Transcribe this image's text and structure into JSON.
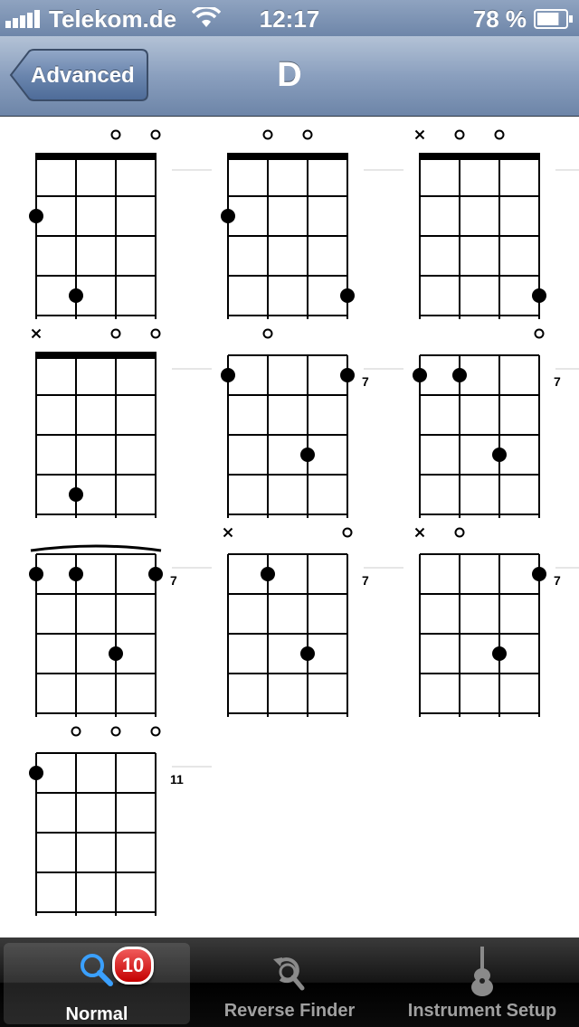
{
  "status_bar": {
    "carrier": "Telekom.de",
    "time": "12:17",
    "battery_percent": "78 %",
    "battery_level": 0.78,
    "signal_bars": 5,
    "icons": [
      "signal-icon",
      "wifi-icon",
      "battery-icon"
    ]
  },
  "nav": {
    "back_label": "Advanced",
    "title": "D"
  },
  "chord_diagrams": [
    {
      "strings": 4,
      "fret_rows": 4,
      "nut": true,
      "top": [
        "",
        "",
        "o",
        "o"
      ],
      "dots": [
        [
          0,
          2
        ],
        [
          1,
          4
        ]
      ],
      "fret_label": ""
    },
    {
      "strings": 4,
      "fret_rows": 4,
      "nut": true,
      "top": [
        "",
        "o",
        "o",
        ""
      ],
      "dots": [
        [
          0,
          2
        ],
        [
          3,
          4
        ]
      ],
      "fret_label": ""
    },
    {
      "strings": 4,
      "fret_rows": 4,
      "nut": true,
      "top": [
        "x",
        "o",
        "o",
        ""
      ],
      "dots": [
        [
          3,
          4
        ]
      ],
      "fret_label": ""
    },
    {
      "strings": 4,
      "fret_rows": 4,
      "nut": true,
      "top": [
        "x",
        "",
        "o",
        "o"
      ],
      "dots": [
        [
          1,
          4
        ]
      ],
      "fret_label": ""
    },
    {
      "strings": 4,
      "fret_rows": 4,
      "nut": false,
      "top": [
        "",
        "o",
        "",
        ""
      ],
      "dots": [
        [
          0,
          1
        ],
        [
          3,
          1
        ],
        [
          2,
          3
        ]
      ],
      "fret_label": "7"
    },
    {
      "strings": 4,
      "fret_rows": 4,
      "nut": false,
      "top": [
        "",
        "",
        "",
        "o"
      ],
      "dots": [
        [
          0,
          1
        ],
        [
          1,
          1
        ],
        [
          2,
          3
        ]
      ],
      "fret_label": "7"
    },
    {
      "strings": 4,
      "fret_rows": 4,
      "nut": false,
      "barre": true,
      "top": [
        "",
        "",
        "",
        ""
      ],
      "dots": [
        [
          0,
          1
        ],
        [
          1,
          1
        ],
        [
          3,
          1
        ],
        [
          2,
          3
        ]
      ],
      "fret_label": "7"
    },
    {
      "strings": 4,
      "fret_rows": 4,
      "nut": false,
      "top": [
        "x",
        "",
        "",
        "o"
      ],
      "dots": [
        [
          1,
          1
        ],
        [
          2,
          3
        ]
      ],
      "fret_label": "7"
    },
    {
      "strings": 4,
      "fret_rows": 4,
      "nut": false,
      "top": [
        "x",
        "o",
        "",
        ""
      ],
      "dots": [
        [
          3,
          1
        ],
        [
          2,
          3
        ]
      ],
      "fret_label": "7"
    },
    {
      "strings": 4,
      "fret_rows": 4,
      "nut": false,
      "top": [
        "",
        "o",
        "o",
        "o"
      ],
      "dots": [
        [
          0,
          1
        ]
      ],
      "fret_label": "11"
    }
  ],
  "tabs": [
    {
      "label": "Normal",
      "icon": "search-icon",
      "selected": true,
      "badge": "10"
    },
    {
      "label": "Reverse Finder",
      "icon": "reverse-search-icon",
      "selected": false
    },
    {
      "label": "Instrument Setup",
      "icon": "guitar-icon",
      "selected": false
    }
  ]
}
